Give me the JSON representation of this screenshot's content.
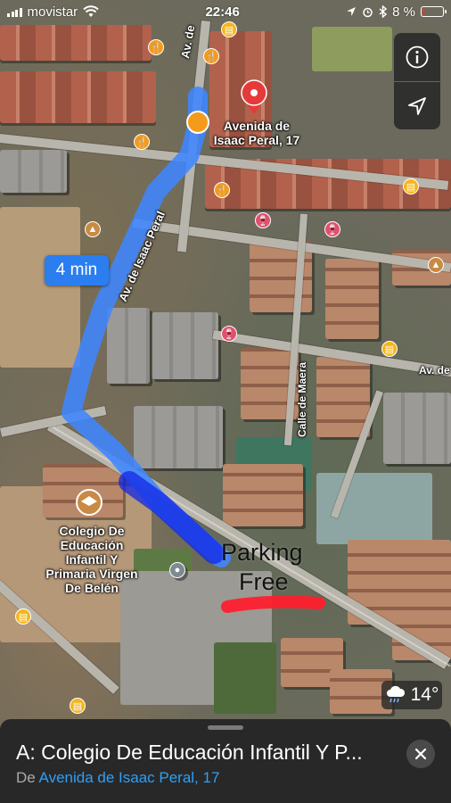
{
  "status_bar": {
    "carrier": "movistar",
    "time": "22:46",
    "battery_percent": "8 %",
    "battery_level": 0.08
  },
  "map": {
    "route_time": "4 min",
    "streets": {
      "av_de_top": "Av. de",
      "av_isaac_peral": "Av. de Isaac Peral",
      "calle_maera": "Calle de Maera",
      "av_de_right": "Av. de"
    },
    "start_pin_label_line1": "Avenida de",
    "start_pin_label_line2": "Isaac Peral, 17",
    "destination_label": [
      "Colegio De",
      "Educación",
      "Infantil Y",
      "Primaria Virgen",
      "De Belén"
    ],
    "annotation_line1": "Parking",
    "annotation_line2": "Free",
    "route_color": "#2f6cf2",
    "highlight_color": "#ff1f2e"
  },
  "controls": {
    "info_icon": "info-icon",
    "location_icon": "location-arrow-icon"
  },
  "weather": {
    "temperature": "14°",
    "icon": "rain-cloud-icon"
  },
  "card": {
    "title": "A: Colegio De Educación Infantil Y P...",
    "from_prefix": "De",
    "from_place": "Avenida de Isaac Peral, 17"
  }
}
